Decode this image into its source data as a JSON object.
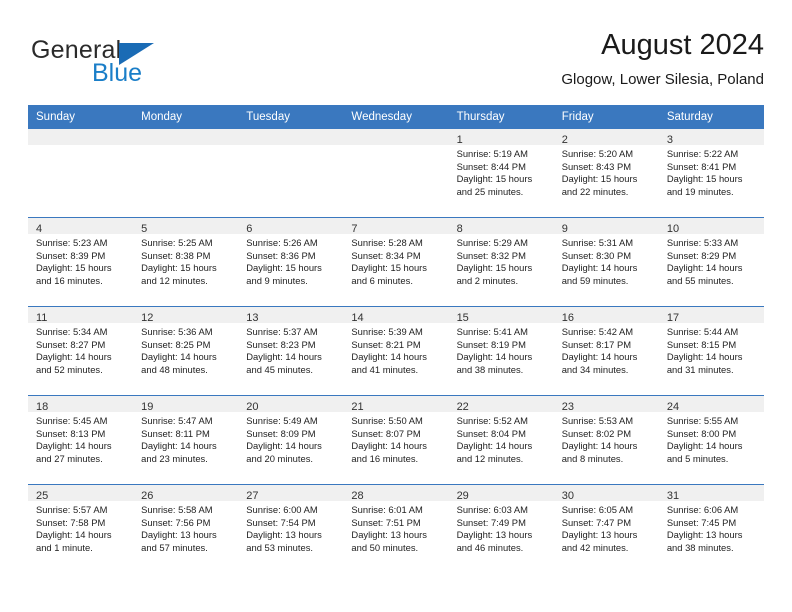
{
  "brand": {
    "name_top": "General",
    "name_bottom": "Blue",
    "top_color": "#2b2b2b",
    "bottom_color": "#1a7ec8",
    "triangle_color": "#1a6bb5"
  },
  "header": {
    "title": "August 2024",
    "subtitle": "Glogow, Lower Silesia, Poland"
  },
  "theme": {
    "header_blue": "#3a78bf",
    "day_band_gray": "#f0f0f0",
    "text_color": "#222222"
  },
  "weekdays": [
    "Sunday",
    "Monday",
    "Tuesday",
    "Wednesday",
    "Thursday",
    "Friday",
    "Saturday"
  ],
  "weeks": [
    [
      {
        "day": "",
        "sunrise": "",
        "sunset": "",
        "daylight_1": "",
        "daylight_2": ""
      },
      {
        "day": "",
        "sunrise": "",
        "sunset": "",
        "daylight_1": "",
        "daylight_2": ""
      },
      {
        "day": "",
        "sunrise": "",
        "sunset": "",
        "daylight_1": "",
        "daylight_2": ""
      },
      {
        "day": "",
        "sunrise": "",
        "sunset": "",
        "daylight_1": "",
        "daylight_2": ""
      },
      {
        "day": "1",
        "sunrise": "Sunrise: 5:19 AM",
        "sunset": "Sunset: 8:44 PM",
        "daylight_1": "Daylight: 15 hours",
        "daylight_2": "and 25 minutes."
      },
      {
        "day": "2",
        "sunrise": "Sunrise: 5:20 AM",
        "sunset": "Sunset: 8:43 PM",
        "daylight_1": "Daylight: 15 hours",
        "daylight_2": "and 22 minutes."
      },
      {
        "day": "3",
        "sunrise": "Sunrise: 5:22 AM",
        "sunset": "Sunset: 8:41 PM",
        "daylight_1": "Daylight: 15 hours",
        "daylight_2": "and 19 minutes."
      }
    ],
    [
      {
        "day": "4",
        "sunrise": "Sunrise: 5:23 AM",
        "sunset": "Sunset: 8:39 PM",
        "daylight_1": "Daylight: 15 hours",
        "daylight_2": "and 16 minutes."
      },
      {
        "day": "5",
        "sunrise": "Sunrise: 5:25 AM",
        "sunset": "Sunset: 8:38 PM",
        "daylight_1": "Daylight: 15 hours",
        "daylight_2": "and 12 minutes."
      },
      {
        "day": "6",
        "sunrise": "Sunrise: 5:26 AM",
        "sunset": "Sunset: 8:36 PM",
        "daylight_1": "Daylight: 15 hours",
        "daylight_2": "and 9 minutes."
      },
      {
        "day": "7",
        "sunrise": "Sunrise: 5:28 AM",
        "sunset": "Sunset: 8:34 PM",
        "daylight_1": "Daylight: 15 hours",
        "daylight_2": "and 6 minutes."
      },
      {
        "day": "8",
        "sunrise": "Sunrise: 5:29 AM",
        "sunset": "Sunset: 8:32 PM",
        "daylight_1": "Daylight: 15 hours",
        "daylight_2": "and 2 minutes."
      },
      {
        "day": "9",
        "sunrise": "Sunrise: 5:31 AM",
        "sunset": "Sunset: 8:30 PM",
        "daylight_1": "Daylight: 14 hours",
        "daylight_2": "and 59 minutes."
      },
      {
        "day": "10",
        "sunrise": "Sunrise: 5:33 AM",
        "sunset": "Sunset: 8:29 PM",
        "daylight_1": "Daylight: 14 hours",
        "daylight_2": "and 55 minutes."
      }
    ],
    [
      {
        "day": "11",
        "sunrise": "Sunrise: 5:34 AM",
        "sunset": "Sunset: 8:27 PM",
        "daylight_1": "Daylight: 14 hours",
        "daylight_2": "and 52 minutes."
      },
      {
        "day": "12",
        "sunrise": "Sunrise: 5:36 AM",
        "sunset": "Sunset: 8:25 PM",
        "daylight_1": "Daylight: 14 hours",
        "daylight_2": "and 48 minutes."
      },
      {
        "day": "13",
        "sunrise": "Sunrise: 5:37 AM",
        "sunset": "Sunset: 8:23 PM",
        "daylight_1": "Daylight: 14 hours",
        "daylight_2": "and 45 minutes."
      },
      {
        "day": "14",
        "sunrise": "Sunrise: 5:39 AM",
        "sunset": "Sunset: 8:21 PM",
        "daylight_1": "Daylight: 14 hours",
        "daylight_2": "and 41 minutes."
      },
      {
        "day": "15",
        "sunrise": "Sunrise: 5:41 AM",
        "sunset": "Sunset: 8:19 PM",
        "daylight_1": "Daylight: 14 hours",
        "daylight_2": "and 38 minutes."
      },
      {
        "day": "16",
        "sunrise": "Sunrise: 5:42 AM",
        "sunset": "Sunset: 8:17 PM",
        "daylight_1": "Daylight: 14 hours",
        "daylight_2": "and 34 minutes."
      },
      {
        "day": "17",
        "sunrise": "Sunrise: 5:44 AM",
        "sunset": "Sunset: 8:15 PM",
        "daylight_1": "Daylight: 14 hours",
        "daylight_2": "and 31 minutes."
      }
    ],
    [
      {
        "day": "18",
        "sunrise": "Sunrise: 5:45 AM",
        "sunset": "Sunset: 8:13 PM",
        "daylight_1": "Daylight: 14 hours",
        "daylight_2": "and 27 minutes."
      },
      {
        "day": "19",
        "sunrise": "Sunrise: 5:47 AM",
        "sunset": "Sunset: 8:11 PM",
        "daylight_1": "Daylight: 14 hours",
        "daylight_2": "and 23 minutes."
      },
      {
        "day": "20",
        "sunrise": "Sunrise: 5:49 AM",
        "sunset": "Sunset: 8:09 PM",
        "daylight_1": "Daylight: 14 hours",
        "daylight_2": "and 20 minutes."
      },
      {
        "day": "21",
        "sunrise": "Sunrise: 5:50 AM",
        "sunset": "Sunset: 8:07 PM",
        "daylight_1": "Daylight: 14 hours",
        "daylight_2": "and 16 minutes."
      },
      {
        "day": "22",
        "sunrise": "Sunrise: 5:52 AM",
        "sunset": "Sunset: 8:04 PM",
        "daylight_1": "Daylight: 14 hours",
        "daylight_2": "and 12 minutes."
      },
      {
        "day": "23",
        "sunrise": "Sunrise: 5:53 AM",
        "sunset": "Sunset: 8:02 PM",
        "daylight_1": "Daylight: 14 hours",
        "daylight_2": "and 8 minutes."
      },
      {
        "day": "24",
        "sunrise": "Sunrise: 5:55 AM",
        "sunset": "Sunset: 8:00 PM",
        "daylight_1": "Daylight: 14 hours",
        "daylight_2": "and 5 minutes."
      }
    ],
    [
      {
        "day": "25",
        "sunrise": "Sunrise: 5:57 AM",
        "sunset": "Sunset: 7:58 PM",
        "daylight_1": "Daylight: 14 hours",
        "daylight_2": "and 1 minute."
      },
      {
        "day": "26",
        "sunrise": "Sunrise: 5:58 AM",
        "sunset": "Sunset: 7:56 PM",
        "daylight_1": "Daylight: 13 hours",
        "daylight_2": "and 57 minutes."
      },
      {
        "day": "27",
        "sunrise": "Sunrise: 6:00 AM",
        "sunset": "Sunset: 7:54 PM",
        "daylight_1": "Daylight: 13 hours",
        "daylight_2": "and 53 minutes."
      },
      {
        "day": "28",
        "sunrise": "Sunrise: 6:01 AM",
        "sunset": "Sunset: 7:51 PM",
        "daylight_1": "Daylight: 13 hours",
        "daylight_2": "and 50 minutes."
      },
      {
        "day": "29",
        "sunrise": "Sunrise: 6:03 AM",
        "sunset": "Sunset: 7:49 PM",
        "daylight_1": "Daylight: 13 hours",
        "daylight_2": "and 46 minutes."
      },
      {
        "day": "30",
        "sunrise": "Sunrise: 6:05 AM",
        "sunset": "Sunset: 7:47 PM",
        "daylight_1": "Daylight: 13 hours",
        "daylight_2": "and 42 minutes."
      },
      {
        "day": "31",
        "sunrise": "Sunrise: 6:06 AM",
        "sunset": "Sunset: 7:45 PM",
        "daylight_1": "Daylight: 13 hours",
        "daylight_2": "and 38 minutes."
      }
    ]
  ]
}
